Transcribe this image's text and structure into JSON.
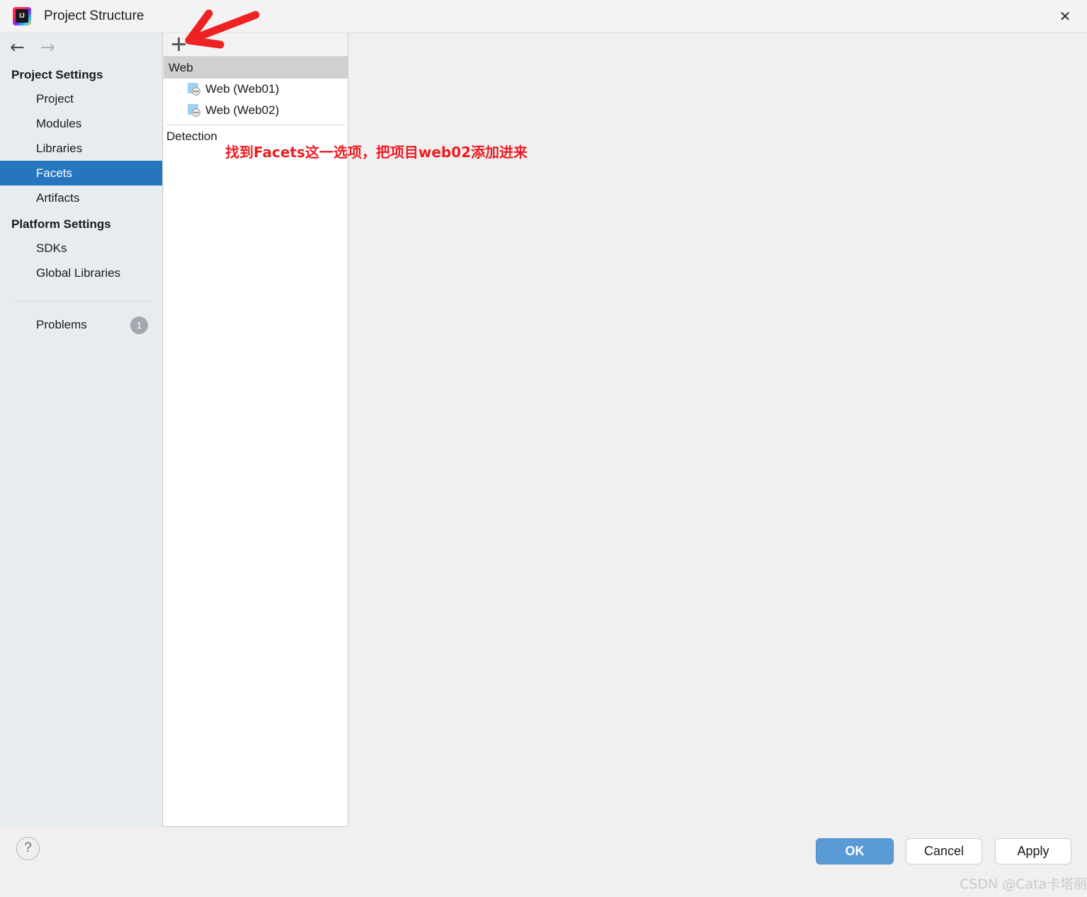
{
  "window": {
    "title": "Project Structure",
    "app_icon": "intellij-idea-icon",
    "icon_glyph": "IJ",
    "close_label": "✕"
  },
  "nav": {
    "back_label": "←",
    "forward_label": "→"
  },
  "sidebar": {
    "groups": [
      {
        "title": "Project Settings",
        "items": [
          {
            "label": "Project",
            "selected": false
          },
          {
            "label": "Modules",
            "selected": false
          },
          {
            "label": "Libraries",
            "selected": false
          },
          {
            "label": "Facets",
            "selected": true
          },
          {
            "label": "Artifacts",
            "selected": false
          }
        ]
      },
      {
        "title": "Platform Settings",
        "items": [
          {
            "label": "SDKs",
            "selected": false
          },
          {
            "label": "Global Libraries",
            "selected": false
          }
        ]
      }
    ],
    "problems": {
      "label": "Problems",
      "count": "1"
    }
  },
  "tree": {
    "toolbar": {
      "add_label": "+"
    },
    "header": "Web",
    "items": [
      {
        "label": "Web (Web01)",
        "icon": "web-facet-icon"
      },
      {
        "label": "Web (Web02)",
        "icon": "web-facet-icon"
      }
    ],
    "detection_label": "Detection"
  },
  "annotation": {
    "text": "找到Facets这一选项，把项目web02添加进来",
    "color": "#ee1c22",
    "arrow": "red-arrow-pointing-to-add-button"
  },
  "footer": {
    "help_label": "?",
    "ok_label": "OK",
    "cancel_label": "Cancel",
    "apply_label": "Apply"
  },
  "watermark": {
    "text": "CSDN @Cata卡塔丽娜"
  },
  "colors": {
    "accent_selection": "#2675bf",
    "ok_button": "#5b9bd5",
    "sidebar_bg": "#e7ecf0",
    "tree_header_bg": "#d0d0d0",
    "annotation_red": "#ee1c22"
  }
}
